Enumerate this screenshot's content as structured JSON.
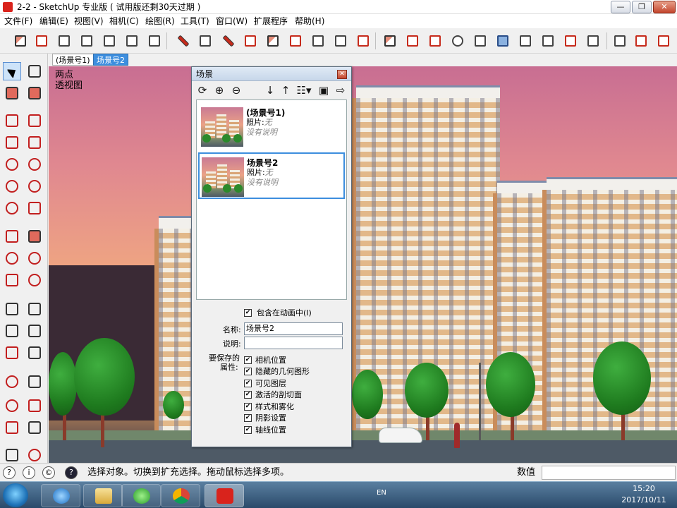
{
  "window": {
    "title": "2-2 - SketchUp 专业版 ( 试用版还剩30天过期 )",
    "minimize": "—",
    "maximize": "❐",
    "close": "✕"
  },
  "menu": [
    "文件(F)",
    "编辑(E)",
    "视图(V)",
    "相机(C)",
    "绘图(R)",
    "工具(T)",
    "窗口(W)",
    "扩展程序",
    "帮助(H)"
  ],
  "tabs": [
    "(场景号1)",
    "场景号2"
  ],
  "viewport": {
    "caption": "两点\n透视图"
  },
  "scenes_panel": {
    "title": "场景",
    "close_icon": "✕",
    "tools": [
      "⟳",
      "⊕",
      "⊖",
      "↓",
      "↑",
      "☷▾",
      "▣",
      "⇨"
    ],
    "scenes": [
      {
        "name": "(场景号1)",
        "photo_label": "照片:",
        "photo_value": "无",
        "description": "没有说明"
      },
      {
        "name": "场景号2",
        "photo_label": "照片:",
        "photo_value": "无",
        "description": "没有说明"
      }
    ],
    "include_in_animation": "包含在动画中(I)",
    "name_label": "名称:",
    "name_value": "场景号2",
    "desc_label": "说明:",
    "desc_value": "",
    "props_label_1": "要保存的",
    "props_label_2": "属性:",
    "properties": [
      "相机位置",
      "隐藏的几何图形",
      "可见图层",
      "激活的剖切面",
      "样式和雾化",
      "阴影设置",
      "轴线位置"
    ],
    "check_mark": "✔"
  },
  "status": {
    "icons": [
      "?",
      "i",
      "©",
      "?"
    ],
    "message": "选择对象。切换到扩充选择。拖动鼠标选择多项。",
    "measure_label": "数值",
    "measure_value": ""
  },
  "taskbar": {
    "language": "EN",
    "time": "15:20",
    "date": "2017/10/11"
  }
}
